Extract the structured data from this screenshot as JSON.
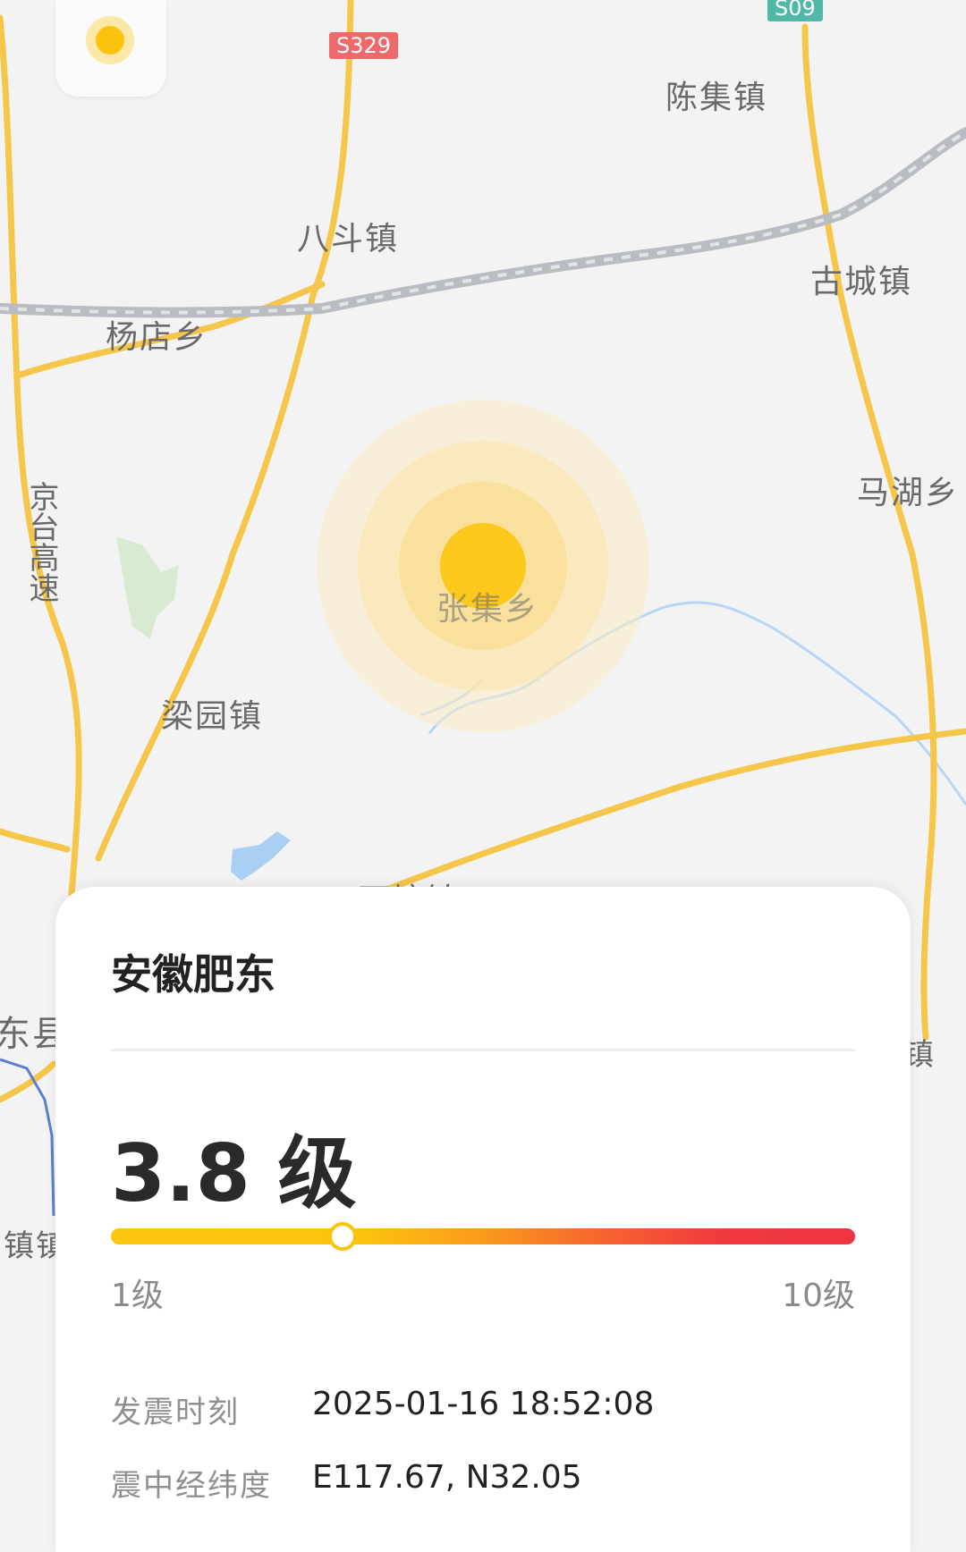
{
  "map": {
    "road_badges": [
      {
        "label": "S329",
        "color": "#ee6a6a"
      },
      {
        "label": "S09",
        "color": "#4fb8a6"
      }
    ],
    "places": {
      "chenji": "陈集镇",
      "badou": "八斗镇",
      "gucheng": "古城镇",
      "yangdian": "杨店乡",
      "mahu": "马湖乡",
      "jingtai": "京台高速",
      "zhangji": "张集乡",
      "liangyuan": "梁园镇",
      "shitang": "石塘镇",
      "dongxian": "东县",
      "zhen_left": "镇镇",
      "zhen_right": "镇"
    },
    "epicenter_icon": "epicenter-pulse-icon",
    "colors": {
      "accent": "#fcc30e",
      "road": "#f5c64a",
      "highway": "#b9bcc2",
      "water": "#a9cff2"
    }
  },
  "location_button_icon": "location-dot-icon",
  "card": {
    "title": "安徽肥东",
    "magnitude": "3.8 级",
    "scale": {
      "min_label": "1级",
      "max_label": "10级",
      "min": 1,
      "max": 10,
      "value": 3.8
    },
    "info": [
      {
        "label": "发震时刻",
        "value": "2025-01-16 18:52:08"
      },
      {
        "label": "震中经纬度",
        "value": "E117.67, N32.05"
      }
    ]
  }
}
